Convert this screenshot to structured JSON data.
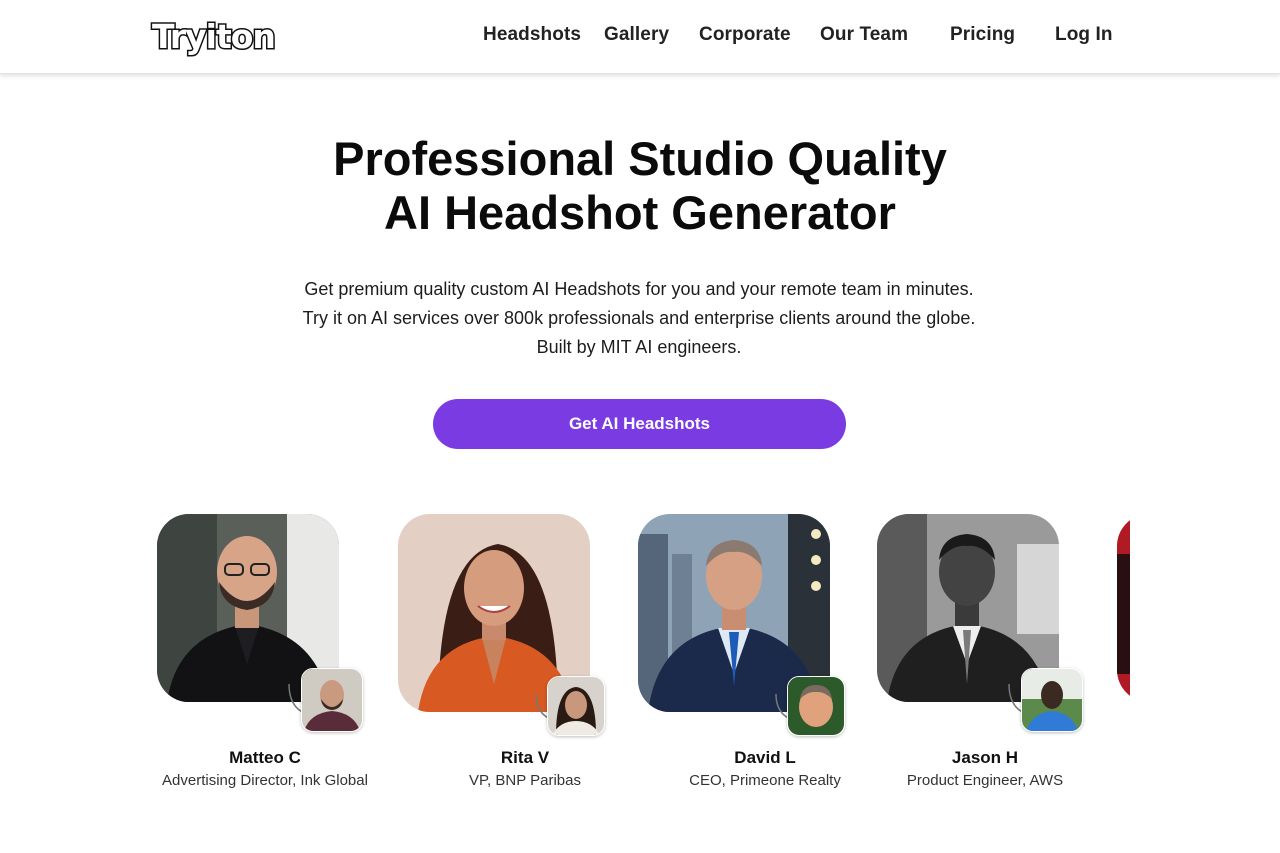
{
  "brand": {
    "logo_text": "Tryiton"
  },
  "nav": {
    "headshots": "Headshots",
    "gallery": "Gallery",
    "corporate": "Corporate",
    "our_team": "Our Team",
    "pricing": "Pricing",
    "login": "Log In"
  },
  "hero": {
    "title_line1": "Professional Studio Quality",
    "title_line2": "AI Headshot Generator",
    "subtitle": "Get premium quality custom AI Headshots for you and your remote team in minutes. Try it on AI services over 800k professionals and enterprise clients around the globe. Built by MIT AI engineers.",
    "cta_label": "Get AI Headshots"
  },
  "testimonials": [
    {
      "name": "Matteo C",
      "role": "Advertising Director, Ink Global"
    },
    {
      "name": "Rita V",
      "role": "VP, BNP Paribas"
    },
    {
      "name": "David L",
      "role": "CEO, Primeone Realty"
    },
    {
      "name": "Jason H",
      "role": "Product Engineer, AWS"
    }
  ],
  "colors": {
    "accent": "#7a3be2",
    "text": "#111111",
    "header_border": "#e3e3e3"
  }
}
